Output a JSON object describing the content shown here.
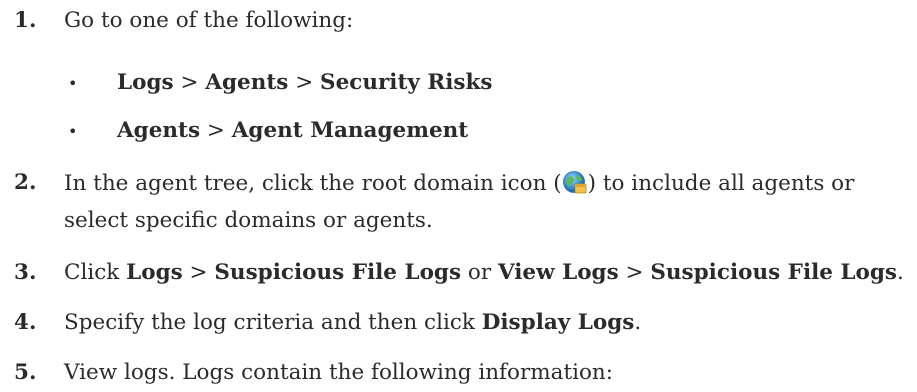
{
  "steps": [
    {
      "num": "1.",
      "text": "Go to one of the following:"
    },
    {
      "num": "2.",
      "pre": "In the agent tree, click the root domain icon (",
      "post": ") to include all agents or",
      "line2": "select specific domains or agents."
    },
    {
      "num": "3.",
      "parts": [
        "Click ",
        "Logs",
        " > ",
        "Suspicious File Logs",
        " or ",
        "View Logs",
        " > ",
        "Suspicious File Logs",
        "."
      ]
    },
    {
      "num": "4.",
      "pre": "Specify the log criteria and then click ",
      "bold": "Display Logs",
      "post": "."
    },
    {
      "num": "5.",
      "text": "View logs. Logs contain the following information:"
    }
  ],
  "sub_items": [
    {
      "bullet": "•",
      "a": "Logs",
      "sep1": " > ",
      "b": "Agents",
      "sep2": " > ",
      "c": "Security Risks"
    },
    {
      "bullet": "•",
      "a": "Agents",
      "sep1": " > ",
      "b": "Agent Management"
    }
  ],
  "icons": {
    "root_domain": "root-domain-globe-icon"
  }
}
